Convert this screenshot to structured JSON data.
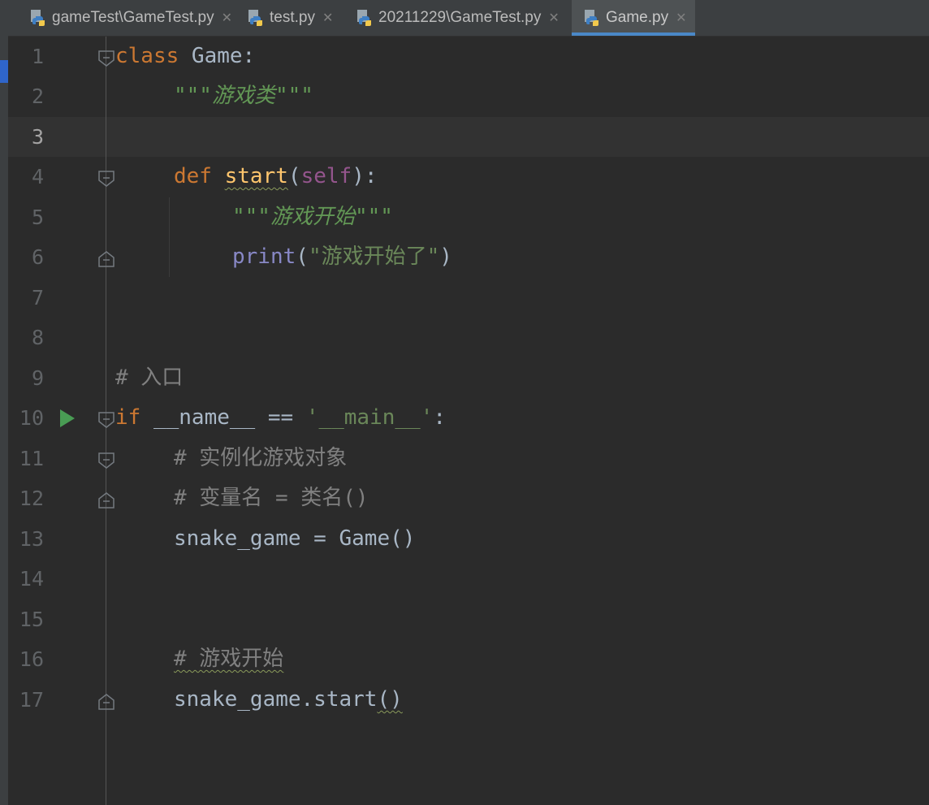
{
  "tabs": [
    {
      "label": "gameTest\\GameTest.py",
      "active": false
    },
    {
      "label": "test.py",
      "active": false
    },
    {
      "label": "20211229\\GameTest.py",
      "active": false
    },
    {
      "label": "Game.py",
      "active": true
    }
  ],
  "editor": {
    "current_line": 3,
    "line_numbers": [
      "1",
      "2",
      "3",
      "4",
      "5",
      "6",
      "7",
      "8",
      "9",
      "10",
      "11",
      "12",
      "13",
      "14",
      "15",
      "16",
      "17"
    ],
    "code": {
      "l1_kw": "class",
      "l1_rest": " Game:",
      "l2_doc": "\"\"\"游戏类\"\"\"",
      "l4_kw": "def",
      "l4_fn": "start",
      "l4_open": "(",
      "l4_self": "self",
      "l4_close": "):",
      "l5_doc": "\"\"\"游戏开始\"\"\"",
      "l6_builtin": "print",
      "l6_open": "(",
      "l6_str": "\"游戏开始了\"",
      "l6_close": ")",
      "l9_cmt": "# 入口",
      "l10_kw": "if",
      "l10_mid": " __name__ == ",
      "l10_str": "'__main__'",
      "l10_end": ":",
      "l11_cmt": "# 实例化游戏对象",
      "l12_cmt": "# 变量名 = 类名()",
      "l13_code": "snake_game = Game()",
      "l16_cmt": "# 游戏开始",
      "l17_code": "snake_game.start",
      "l17_paren": "()"
    }
  },
  "colors": {
    "background": "#2b2b2b",
    "keyword": "#cc7832",
    "function": "#ffc66d",
    "self": "#94558d",
    "builtin": "#8888c6",
    "string": "#6a8759",
    "comment": "#808080",
    "active_tab_underline": "#4a88c7"
  }
}
